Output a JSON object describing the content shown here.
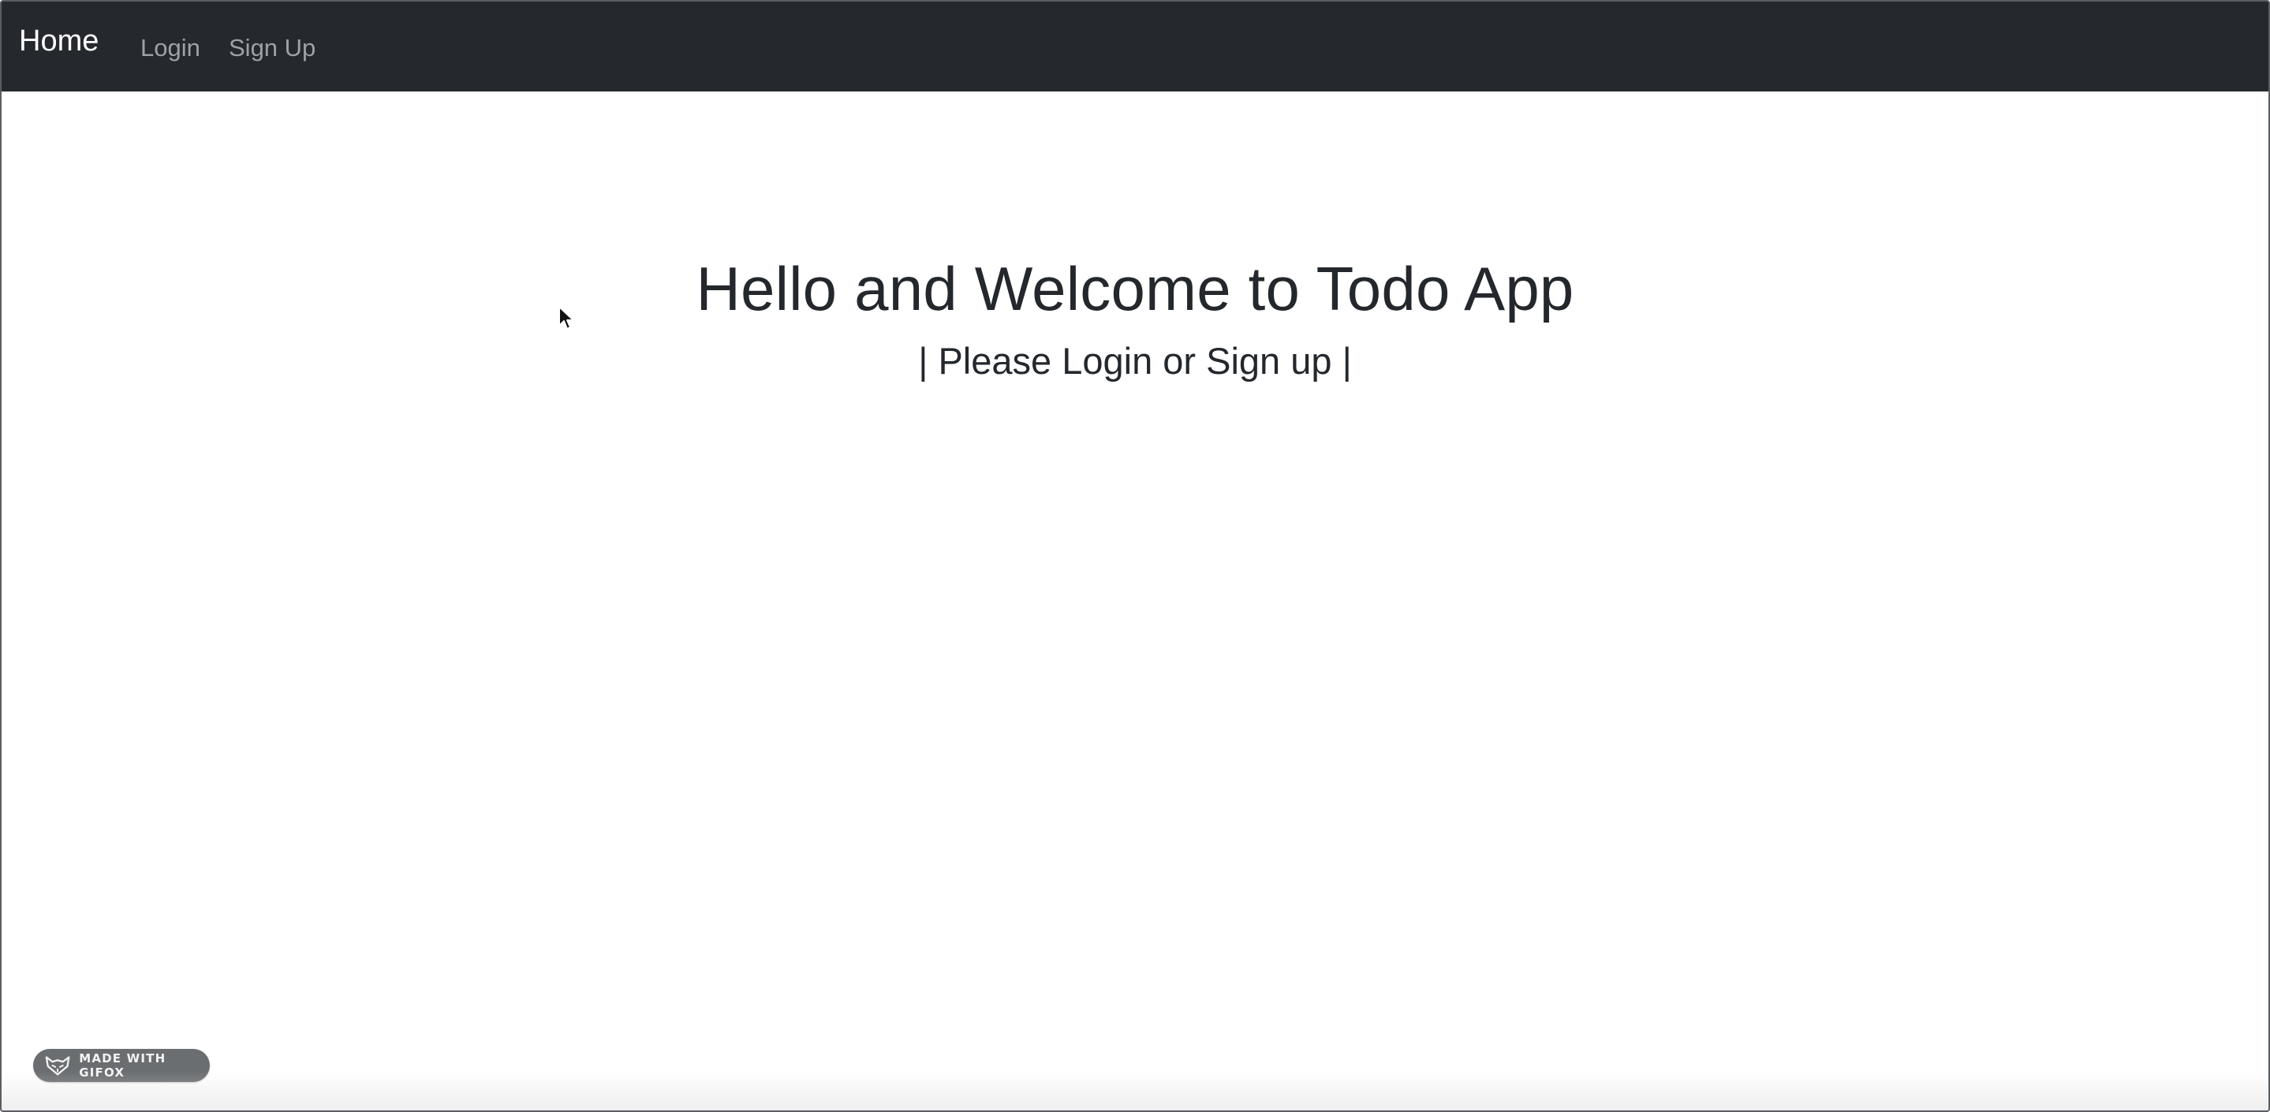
{
  "navbar": {
    "brand": "Home",
    "links": [
      {
        "label": "Login"
      },
      {
        "label": "Sign Up"
      }
    ]
  },
  "hero": {
    "title": "Hello and Welcome to Todo App",
    "subtitle": "| Please Login or Sign up |"
  },
  "badge": {
    "text": "MADE WITH GIFOX",
    "icon": "gifox-fox-icon"
  },
  "colors": {
    "navbar_bg": "#25292e",
    "brand_text": "#ffffff",
    "nav_link_text": "#9da2a8",
    "heading_text": "#24282d",
    "badge_bg": "#6b6e71"
  }
}
